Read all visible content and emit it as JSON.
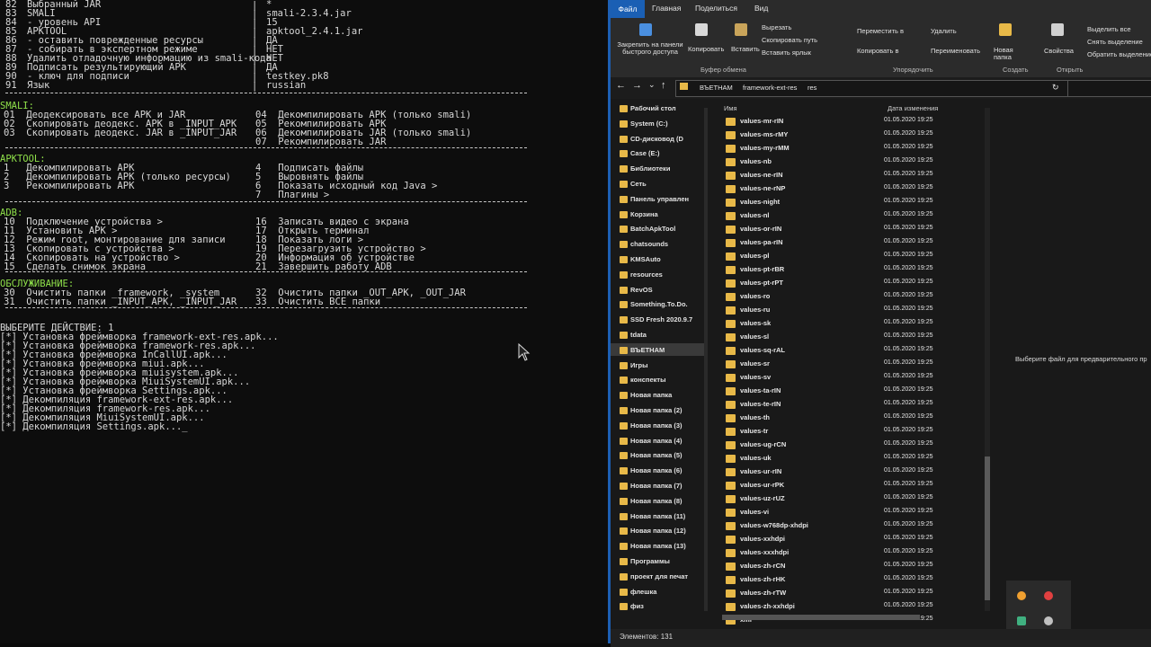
{
  "console": {
    "top_block": [
      {
        "n": "82",
        "left": "Выбранный JAR",
        "right": "*"
      },
      {
        "n": "83",
        "left": "SMALI",
        "right": "smali-2.3.4.jar"
      },
      {
        "n": "84",
        "left": "- уровень API",
        "right": "15"
      },
      {
        "n": "85",
        "left": "APKTOOL",
        "right": "apktool_2.4.1.jar"
      },
      {
        "n": "86",
        "left": "- оставить поврежденные ресурсы",
        "right": "ДА"
      },
      {
        "n": "87",
        "left": "- собирать в экспертном режиме",
        "right": "НЕТ"
      },
      {
        "n": "88",
        "left": "Удалить отладочную информацию из smali-кода",
        "right": "НЕТ"
      },
      {
        "n": "89",
        "left": "Подписать результирующий APK",
        "right": "ДА"
      },
      {
        "n": "90",
        "left": "- ключ для подписи",
        "right": "testkey.pk8"
      },
      {
        "n": "91",
        "left": "Язык",
        "right": "russian"
      }
    ],
    "smali_header": "SMALI:",
    "smali": [
      {
        "left": "01  Деодексировать все APK и JAR",
        "right": "04  Декомпилировать APK (только smali)"
      },
      {
        "left": "02  Скопировать деодекс. APK в _INPUT_APK",
        "right": "05  Рекомпилировать APK"
      },
      {
        "left": "03  Скопировать деодекс. JAR в _INPUT_JAR",
        "right": "06  Декомпилировать JAR (только smali)"
      },
      {
        "left": "",
        "right": "07  Рекомпилировать JAR"
      }
    ],
    "apktool_header": "APKTOOL:",
    "apktool": [
      {
        "left": "1   Декомпилировать APK",
        "right": "4   Подписать файлы"
      },
      {
        "left": "2   Декомпилировать APK (только ресурсы)",
        "right": "5   Выровнять файлы"
      },
      {
        "left": "3   Рекомпилировать APK",
        "right": "6   Показать исходный код Java >"
      },
      {
        "left": "",
        "right": "7   Плагины >"
      }
    ],
    "adb_header": "ADB:",
    "adb": [
      {
        "left": "10  Подключение устройства >",
        "right": "16  Записать видео с экрана"
      },
      {
        "left": "11  Установить APK >",
        "right": "17  Открыть терминал"
      },
      {
        "left": "12  Режим root, монтирование для записи",
        "right": "18  Показать логи >"
      },
      {
        "left": "13  Скопировать с устройства >",
        "right": "19  Перезагрузить устройство >"
      },
      {
        "left": "14  Скопировать на устройство >",
        "right": "20  Информация об устройстве"
      },
      {
        "left": "15  Сделать снимок экрана",
        "right": "21  Завершить работу ADB"
      }
    ],
    "service_header": "ОБСЛУЖИВАНИЕ:",
    "service": [
      {
        "left": "30  Очистить папки _framework, _system",
        "right": "32  Очистить папки _OUT_APK, _OUT_JAR"
      },
      {
        "left": "31  Очистить папки _INPUT_APK, _INPUT_JAR",
        "right": "33  Очистить ВСЕ папки"
      }
    ],
    "prompt": "ВЫБЕРИТЕ ДЕЙСТВИЕ: 1",
    "log": [
      "[*] Установка фреймворка framework-ext-res.apk...",
      "[*] Установка фреймворка framework-res.apk...",
      "[*] Установка фреймворка InCallUI.apk...",
      "[*] Установка фреймворка miui.apk...",
      "[*] Установка фреймворка miuisystem.apk...",
      "[*] Установка фреймворка MiuiSystemUI.apk...",
      "[*] Установка фреймворка Settings.apk...",
      "[*] Декомпиляция framework-ext-res.apk...",
      "[*] Декомпиляция framework-res.apk...",
      "[*] Декомпиляция MiuiSystemUI.apk...",
      "[*] Декомпиляция Settings.apk..._"
    ]
  },
  "explorer": {
    "tabs": {
      "file": "Файл",
      "home": "Главная",
      "share": "Поделиться",
      "view": "Вид"
    },
    "ribbon": {
      "pin": "Закрепить на панели быстрого доступа",
      "copy": "Копировать",
      "paste": "Вставить",
      "cut": "Вырезать",
      "copy_path": "Скопировать путь",
      "paste_shortcut": "Вставить ярлык",
      "move_to": "Переместить в",
      "copy_to": "Копировать в",
      "delete": "Удалить",
      "rename": "Переименовать",
      "new_folder": "Новая папка",
      "properties": "Свойства",
      "select_all": "Выделить все",
      "select_none": "Снять выделение",
      "invert": "Обратить выделение",
      "group_clipboard": "Буфер обмена",
      "group_organize": "Упорядочить",
      "group_create": "Создать",
      "group_open": "Открыть"
    },
    "breadcrumb": [
      "ВЪЕТНАМ",
      "framework-ext-res",
      "res"
    ],
    "columns": {
      "name": "Имя",
      "date": "Дата изменения"
    },
    "nav": [
      "Рабочий стол",
      "System (C:)",
      "CD-дисковод (D",
      "Case (E:)",
      "Библиотеки",
      "Сеть",
      "Панель управлен",
      "Корзина",
      "BatchApkTool",
      "chatsounds",
      "KMSAuto",
      "resources",
      "RevOS",
      "Something.To.Do.",
      "SSD Fresh 2020.9.7",
      "tdata",
      "ВЪЕТНАМ",
      "Игры",
      "конспекты",
      "Новая папка",
      "Новая папка (2)",
      "Новая папка (3)",
      "Новая папка (4)",
      "Новая папка (5)",
      "Новая папка (6)",
      "Новая папка (7)",
      "Новая папка (8)",
      "Новая папка (11)",
      "Новая папка (12)",
      "Новая папка (13)",
      "Программы",
      "проект для печат",
      "флешка",
      "физ"
    ],
    "files": [
      {
        "name": "values-mr-rIN",
        "date": "01.05.2020 19:25"
      },
      {
        "name": "values-ms-rMY",
        "date": "01.05.2020 19:25"
      },
      {
        "name": "values-my-rMM",
        "date": "01.05.2020 19:25"
      },
      {
        "name": "values-nb",
        "date": "01.05.2020 19:25"
      },
      {
        "name": "values-ne-rIN",
        "date": "01.05.2020 19:25"
      },
      {
        "name": "values-ne-rNP",
        "date": "01.05.2020 19:25"
      },
      {
        "name": "values-night",
        "date": "01.05.2020 19:25"
      },
      {
        "name": "values-nl",
        "date": "01.05.2020 19:25"
      },
      {
        "name": "values-or-rIN",
        "date": "01.05.2020 19:25"
      },
      {
        "name": "values-pa-rIN",
        "date": "01.05.2020 19:25"
      },
      {
        "name": "values-pl",
        "date": "01.05.2020 19:25"
      },
      {
        "name": "values-pt-rBR",
        "date": "01.05.2020 19:25"
      },
      {
        "name": "values-pt-rPT",
        "date": "01.05.2020 19:25"
      },
      {
        "name": "values-ro",
        "date": "01.05.2020 19:25"
      },
      {
        "name": "values-ru",
        "date": "01.05.2020 19:25"
      },
      {
        "name": "values-sk",
        "date": "01.05.2020 19:25"
      },
      {
        "name": "values-sl",
        "date": "01.05.2020 19:25"
      },
      {
        "name": "values-sq-rAL",
        "date": "01.05.2020 19:25"
      },
      {
        "name": "values-sr",
        "date": "01.05.2020 19:25"
      },
      {
        "name": "values-sv",
        "date": "01.05.2020 19:25"
      },
      {
        "name": "values-ta-rIN",
        "date": "01.05.2020 19:25"
      },
      {
        "name": "values-te-rIN",
        "date": "01.05.2020 19:25"
      },
      {
        "name": "values-th",
        "date": "01.05.2020 19:25"
      },
      {
        "name": "values-tr",
        "date": "01.05.2020 19:25"
      },
      {
        "name": "values-ug-rCN",
        "date": "01.05.2020 19:25"
      },
      {
        "name": "values-uk",
        "date": "01.05.2020 19:25"
      },
      {
        "name": "values-ur-rIN",
        "date": "01.05.2020 19:25"
      },
      {
        "name": "values-ur-rPK",
        "date": "01.05.2020 19:25"
      },
      {
        "name": "values-uz-rUZ",
        "date": "01.05.2020 19:25"
      },
      {
        "name": "values-vi",
        "date": "01.05.2020 19:25"
      },
      {
        "name": "values-w768dp-xhdpi",
        "date": "01.05.2020 19:25"
      },
      {
        "name": "values-xxhdpi",
        "date": "01.05.2020 19:25"
      },
      {
        "name": "values-xxxhdpi",
        "date": "01.05.2020 19:25"
      },
      {
        "name": "values-zh-rCN",
        "date": "01.05.2020 19:25"
      },
      {
        "name": "values-zh-rHK",
        "date": "01.05.2020 19:25"
      },
      {
        "name": "values-zh-rTW",
        "date": "01.05.2020 19:25"
      },
      {
        "name": "values-zh-xxhdpi",
        "date": "01.05.2020 19:25"
      },
      {
        "name": "xml",
        "date": "01.05.2020 19:25"
      }
    ],
    "preview_hint": "Выберите файл для предварительного пр",
    "status": "Элементов: 131"
  }
}
